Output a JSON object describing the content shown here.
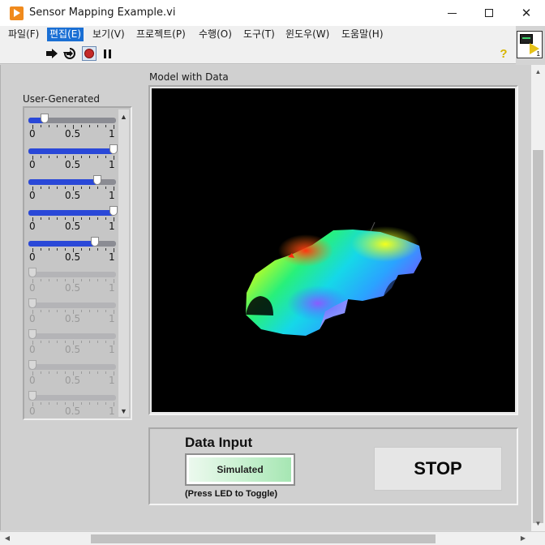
{
  "window": {
    "title": "Sensor Mapping Example.vi",
    "controls": {
      "minimize": "—",
      "maximize": "☐",
      "close": "✕"
    }
  },
  "menubar": {
    "items": [
      {
        "label": "파일(F)",
        "active": false
      },
      {
        "label": "편집(E)",
        "active": true
      },
      {
        "label": "보기(V)",
        "active": false
      },
      {
        "label": "프로젝트(P)",
        "active": false
      },
      {
        "label": "수행(O)",
        "active": false
      },
      {
        "label": "도구(T)",
        "active": false
      },
      {
        "label": "윈도우(W)",
        "active": false
      },
      {
        "label": "도움말(H)",
        "active": false
      }
    ]
  },
  "toolbar": {
    "icons": [
      "run-arrow-icon",
      "run-continuously-icon",
      "abort-execution-icon",
      "pause-icon",
      "context-help-icon"
    ],
    "help_glyph": "?"
  },
  "vi_icon": {
    "number": "1"
  },
  "sliders": {
    "label": "User-Generated",
    "scale": {
      "min_label": "0",
      "mid_label": "0.5",
      "max_label": "1"
    },
    "items": [
      {
        "value": 0.15,
        "enabled": true
      },
      {
        "value": 1.0,
        "enabled": true
      },
      {
        "value": 0.8,
        "enabled": true
      },
      {
        "value": 1.0,
        "enabled": true
      },
      {
        "value": 0.77,
        "enabled": true
      },
      {
        "value": 0.0,
        "enabled": false
      },
      {
        "value": 0.0,
        "enabled": false
      },
      {
        "value": 0.0,
        "enabled": false
      },
      {
        "value": 0.0,
        "enabled": false
      },
      {
        "value": 0.0,
        "enabled": false
      }
    ]
  },
  "model": {
    "label": "Model with Data"
  },
  "data_input": {
    "title": "Data Input",
    "led_label": "Simulated",
    "hint": "(Press LED to Toggle)"
  },
  "stop_button": {
    "label": "STOP"
  },
  "colors": {
    "slider_fill": "#2a48d8",
    "highlight_menu": "#1a6fd4",
    "model_bg": "#000000",
    "led_green": "#a6e6b3"
  }
}
